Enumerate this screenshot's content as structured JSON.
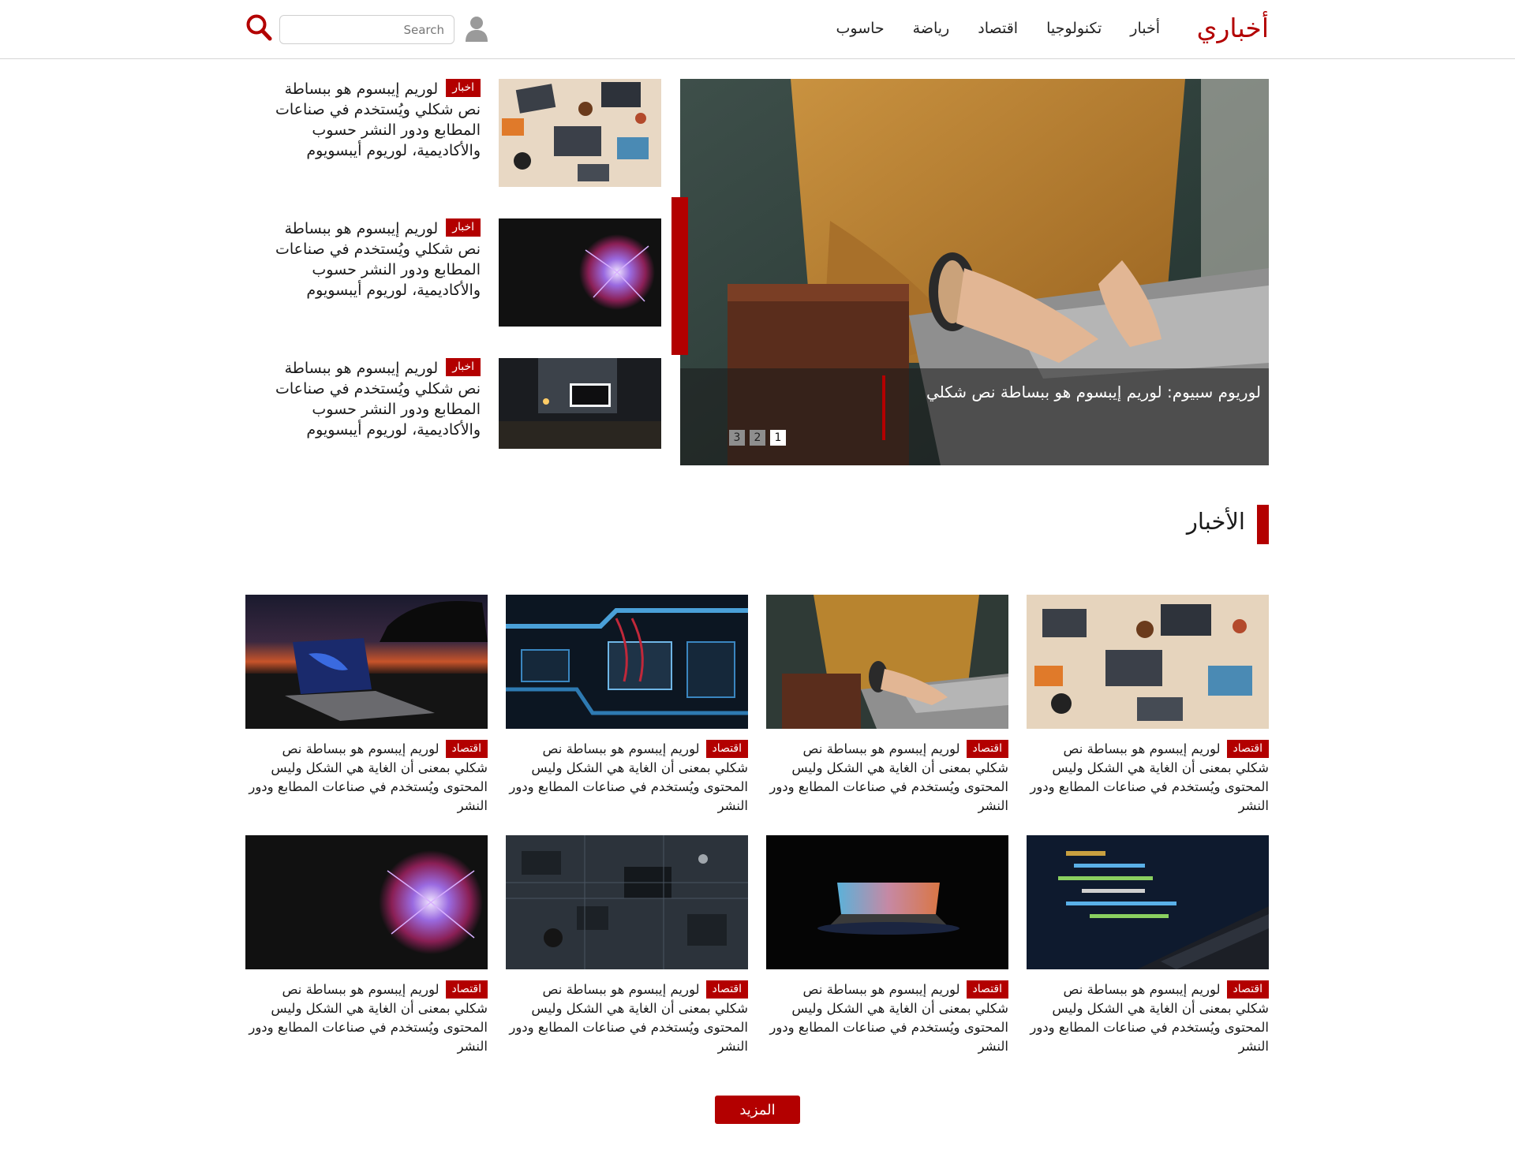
{
  "header": {
    "logo": "أخباري",
    "nav": [
      "أخبار",
      "تكنولوجيا",
      "اقتصاد",
      "رياضة",
      "حاسوب"
    ],
    "search_placeholder": "Search",
    "user_icon": "user-icon",
    "search_icon": "search-icon"
  },
  "hero": {
    "caption": "لوريوم سبيوم: لوريم إيبسوم هو ببساطة نص شكلي",
    "pages": [
      "1",
      "2",
      "3"
    ],
    "active_page": "1"
  },
  "side_items": [
    {
      "tag": "اخبار",
      "text": "لوريم إيبسوم هو ببساطة نص شكلي ويُستخدم في صناعات المطابع ودور النشر حسوب والأكاديمية، لوريوم أيبسويوم"
    },
    {
      "tag": "اخبار",
      "text": "لوريم إيبسوم هو ببساطة نص شكلي ويُستخدم في صناعات المطابع ودور النشر حسوب والأكاديمية، لوريوم أيبسويوم"
    },
    {
      "tag": "اخبار",
      "text": "لوريم إيبسوم هو ببساطة نص شكلي ويُستخدم في صناعات المطابع ودور النشر حسوب والأكاديمية، لوريوم أيبسويوم"
    }
  ],
  "section": {
    "title": "الأخبار"
  },
  "cards": [
    {
      "tag": "اقتصاد",
      "text": "لوريم إيبسوم هو ببساطة نص شكلي بمعنى أن الغاية هي الشكل وليس المحتوى ويُستخدم في صناعات المطابع ودور النشر"
    },
    {
      "tag": "اقتصاد",
      "text": "لوريم إيبسوم هو ببساطة نص شكلي بمعنى أن الغاية هي الشكل وليس المحتوى ويُستخدم في صناعات المطابع ودور النشر"
    },
    {
      "tag": "اقتصاد",
      "text": "لوريم إيبسوم هو ببساطة نص شكلي بمعنى أن الغاية هي الشكل وليس المحتوى ويُستخدم في صناعات المطابع ودور النشر"
    },
    {
      "tag": "اقتصاد",
      "text": "لوريم إيبسوم هو ببساطة نص شكلي بمعنى أن الغاية هي الشكل وليس المحتوى ويُستخدم في صناعات المطابع ودور النشر"
    },
    {
      "tag": "اقتصاد",
      "text": "لوريم إيبسوم هو ببساطة نص شكلي بمعنى أن الغاية هي الشكل وليس المحتوى ويُستخدم في صناعات المطابع ودور النشر"
    },
    {
      "tag": "اقتصاد",
      "text": "لوريم إيبسوم هو ببساطة نص شكلي بمعنى أن الغاية هي الشكل وليس المحتوى ويُستخدم في صناعات المطابع ودور النشر"
    },
    {
      "tag": "اقتصاد",
      "text": "لوريم إيبسوم هو ببساطة نص شكلي بمعنى أن الغاية هي الشكل وليس المحتوى ويُستخدم في صناعات المطابع ودور النشر"
    },
    {
      "tag": "اقتصاد",
      "text": "لوريم إيبسوم هو ببساطة نص شكلي بمعنى أن الغاية هي الشكل وليس المحتوى ويُستخدم في صناعات المطابع ودور النشر"
    }
  ],
  "more_button": "المزيد",
  "colors": {
    "accent": "#b30000"
  }
}
